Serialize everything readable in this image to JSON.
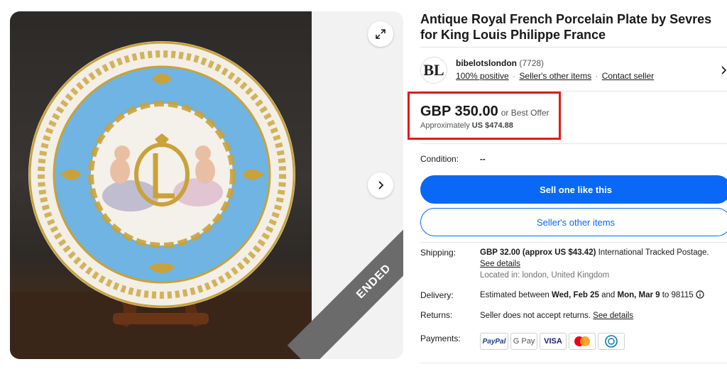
{
  "listing": {
    "title": "Antique Royal French Porcelain Plate by Sevres for King Louis Philippe France",
    "status_ribbon": "ENDED"
  },
  "gallery": {
    "expand_icon": "expand-icon",
    "next_icon": "chevron-right-icon"
  },
  "seller": {
    "logo_text": "BL",
    "name": "bibelotslondon",
    "feedback_count": "(7728)",
    "positive": "100% positive",
    "other_items_link": "Seller's other items",
    "contact_link": "Contact seller",
    "separator": "·"
  },
  "price": {
    "amount": "GBP 350.00",
    "best_offer": "or Best Offer",
    "approx_prefix": "Approximately",
    "approx_value": "US $474.88"
  },
  "condition": {
    "label": "Condition:",
    "value": "--"
  },
  "buttons": {
    "sell_one": "Sell one like this",
    "other_items": "Seller's other items"
  },
  "shipping": {
    "label": "Shipping:",
    "cost": "GBP 32.00 (approx US $43.42)",
    "service": " International Tracked Postage.",
    "details_link": "See details",
    "location": "Located in: london, United Kingdom"
  },
  "delivery": {
    "label": "Delivery:",
    "prefix": "Estimated between ",
    "start": "Wed, Feb 25",
    "and": " and ",
    "end": "Mon, Mar 9",
    "suffix": " to 98115 "
  },
  "returns": {
    "label": "Returns:",
    "text": "Seller does not accept returns. ",
    "details_link": "See details"
  },
  "payments": {
    "label": "Payments:",
    "methods": [
      "PayPal",
      "G Pay",
      "VISA",
      "Mastercard",
      "Diners Club"
    ],
    "paypal_label": "PayPal",
    "gpay_label": "G Pay",
    "visa_label": "VISA"
  },
  "colors": {
    "accent_blue": "#0968f6",
    "highlight_red": "#e21a1a",
    "ribbon_gray": "#6b6b6b",
    "plate_blue": "#6fb4e3",
    "plate_gold": "#c9a23a"
  }
}
